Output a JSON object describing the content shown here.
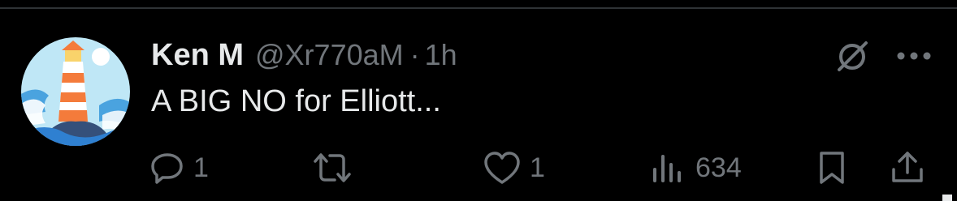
{
  "tweet": {
    "author_name": "Ken M",
    "handle": "@Xr770aM",
    "separator": "·",
    "time": "1h",
    "text": "A BIG NO for Elliott..."
  },
  "actions": {
    "reply_count": "1",
    "retweet_count": "",
    "like_count": "1",
    "views_count": "634"
  },
  "icons": {
    "avatar": "lighthouse-avatar",
    "grok": "grok-icon",
    "more": "more-dots-icon",
    "reply": "reply-icon",
    "retweet": "retweet-icon",
    "like": "heart-icon",
    "views": "views-icon",
    "bookmark": "bookmark-icon",
    "share": "share-icon"
  },
  "colors": {
    "background": "#000000",
    "primary_text": "#e7e9ea",
    "secondary_text": "#71767b",
    "divider": "#2f3336"
  }
}
